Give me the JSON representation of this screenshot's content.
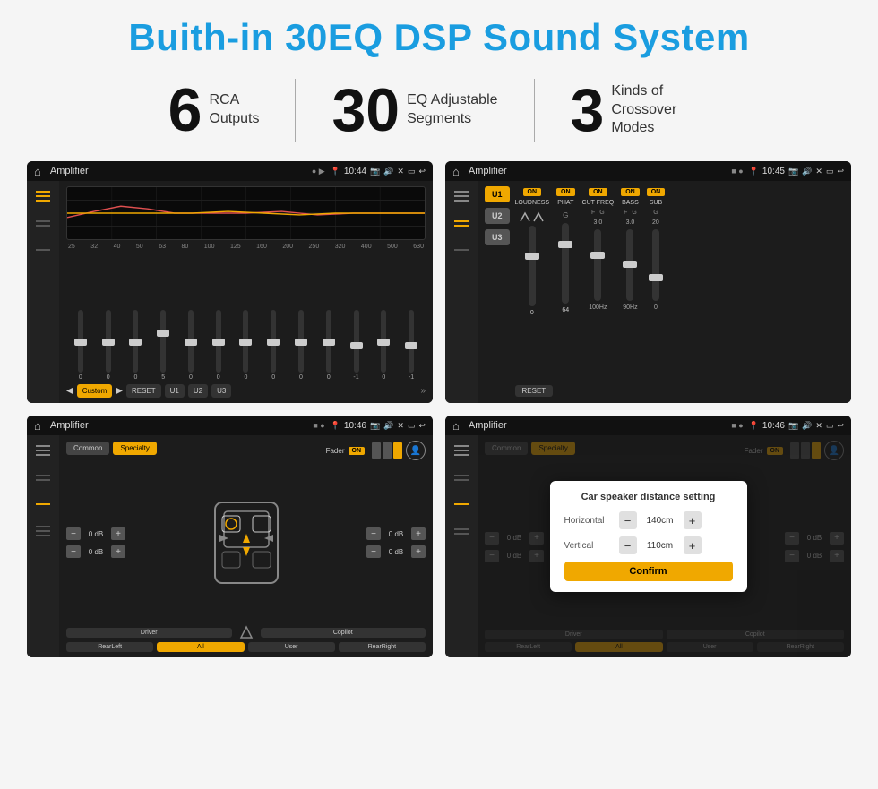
{
  "title": "Buith-in 30EQ DSP Sound System",
  "stats": [
    {
      "number": "6",
      "desc_line1": "RCA",
      "desc_line2": "Outputs"
    },
    {
      "number": "30",
      "desc_line1": "EQ Adjustable",
      "desc_line2": "Segments"
    },
    {
      "number": "3",
      "desc_line1": "Kinds of",
      "desc_line2": "Crossover Modes"
    }
  ],
  "screen1": {
    "app": "Amplifier",
    "time": "10:44",
    "eq_freqs": [
      "25",
      "32",
      "40",
      "50",
      "63",
      "80",
      "100",
      "125",
      "160",
      "200",
      "250",
      "320",
      "400",
      "500",
      "630"
    ],
    "eq_values": [
      "0",
      "0",
      "0",
      "5",
      "0",
      "0",
      "0",
      "0",
      "0",
      "0",
      "-1",
      "0",
      "-1"
    ],
    "buttons": [
      "Custom",
      "RESET",
      "U1",
      "U2",
      "U3"
    ]
  },
  "screen2": {
    "app": "Amplifier",
    "time": "10:45",
    "u_buttons": [
      "U1",
      "U2",
      "U3"
    ],
    "controls": [
      "LOUDNESS",
      "PHAT",
      "CUT FREQ",
      "BASS",
      "SUB"
    ],
    "reset": "RESET"
  },
  "screen3": {
    "app": "Amplifier",
    "time": "10:46",
    "tabs": [
      "Common",
      "Specialty"
    ],
    "active_tab": "Specialty",
    "fader_label": "Fader",
    "fader_on": "ON",
    "left_db": [
      "0 dB",
      "0 dB"
    ],
    "right_db": [
      "0 dB",
      "0 dB"
    ],
    "bottom_buttons": [
      "Driver",
      "",
      "Copilot",
      "RearLeft",
      "All",
      "User",
      "RearRight"
    ]
  },
  "screen4": {
    "app": "Amplifier",
    "time": "10:46",
    "tabs": [
      "Common",
      "Specialty"
    ],
    "dialog_title": "Car speaker distance setting",
    "horizontal_label": "Horizontal",
    "horizontal_value": "140cm",
    "vertical_label": "Vertical",
    "vertical_value": "110cm",
    "confirm_label": "Confirm",
    "right_db": [
      "0 dB",
      "0 dB"
    ],
    "bottom_buttons": [
      "Driver",
      "Copilot",
      "RearLeft",
      "All",
      "User",
      "RearRight"
    ]
  }
}
